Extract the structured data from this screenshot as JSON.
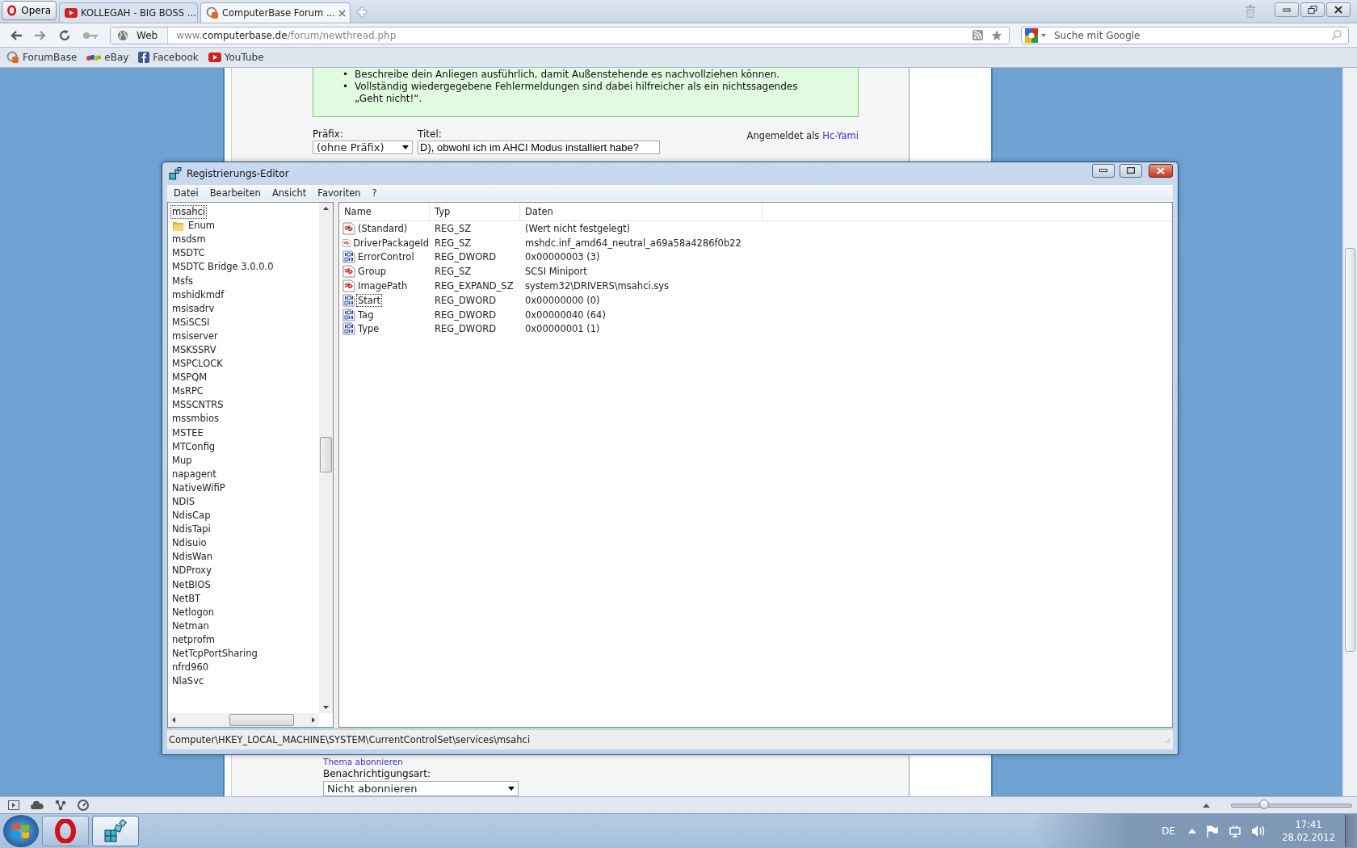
{
  "browser": {
    "menu_button": "Opera",
    "tabs": [
      {
        "title": "KOLLEGAH - BIG BOSS ...",
        "kind": "video",
        "selected": false
      },
      {
        "title": "ComputerBase Forum ...",
        "kind": "forum",
        "selected": true
      }
    ],
    "scope": "Web",
    "url": "www.**computerbase.de**/forum/newthread.php",
    "search_placeholder": "Suche mit Google",
    "bookmarks": [
      {
        "label": "ForumBase",
        "kind": "forum"
      },
      {
        "label": "eBay",
        "kind": "shop"
      },
      {
        "label": "Facebook",
        "kind": "social"
      },
      {
        "label": "YouTube",
        "kind": "video"
      }
    ],
    "zoom_slider": {
      "level": 0.27
    }
  },
  "page": {
    "hints": [
      {
        "marker": "•",
        "text": "Beschreibe dein Anliegen ausführlich, damit Außenstehende es nachvollziehen können."
      },
      {
        "marker": "•",
        "text": "Vollständig wiedergegebene Fehlermeldungen sind dabei hilfreicher als ein nichtssagendes „Geht nicht!“."
      }
    ],
    "prefix_label": "Präfix:",
    "prefix_value": "(ohne Präfix)",
    "title_label": "Titel:",
    "title_value": "D), obwohl ich im AHCI Modus installiert habe?",
    "logged_in_text": "Angemeldet als",
    "user_link": "Hc-Yami",
    "subscribe_link": "Thema abonnieren",
    "notification_label": "Benachrichtigungsart:",
    "notification_value": "Nicht abonnieren"
  },
  "regedit": {
    "title": "Registrierungs-Editor",
    "menu": [
      "Datei",
      "Bearbeiten",
      "Ansicht",
      "Favoriten",
      "?"
    ],
    "tree": [
      {
        "label": "msahci",
        "selected": true,
        "children": [
          {
            "label": "Enum",
            "selected": false
          }
        ]
      },
      {
        "label": "msdsm",
        "selected": false
      },
      {
        "label": "MSDTC",
        "selected": false
      },
      {
        "label": "MSDTC Bridge 3.0.0.0",
        "selected": false
      },
      {
        "label": "Msfs",
        "selected": false
      },
      {
        "label": "mshidkmdf",
        "selected": false
      },
      {
        "label": "msisadrv",
        "selected": false
      },
      {
        "label": "MSiSCSI",
        "selected": false
      },
      {
        "label": "msiserver",
        "selected": false
      },
      {
        "label": "MSKSSRV",
        "selected": false
      },
      {
        "label": "MSPCLOCK",
        "selected": false
      },
      {
        "label": "MSPQM",
        "selected": false
      },
      {
        "label": "MsRPC",
        "selected": false
      },
      {
        "label": "MSSCNTRS",
        "selected": false
      },
      {
        "label": "mssmbios",
        "selected": false
      },
      {
        "label": "MSTEE",
        "selected": false
      },
      {
        "label": "MTConfig",
        "selected": false
      },
      {
        "label": "Mup",
        "selected": false
      },
      {
        "label": "napagent",
        "selected": false
      },
      {
        "label": "NativeWifiP",
        "selected": false
      },
      {
        "label": "NDIS",
        "selected": false
      },
      {
        "label": "NdisCap",
        "selected": false
      },
      {
        "label": "NdisTapi",
        "selected": false
      },
      {
        "label": "Ndisuio",
        "selected": false
      },
      {
        "label": "NdisWan",
        "selected": false
      },
      {
        "label": "NDProxy",
        "selected": false
      },
      {
        "label": "NetBIOS",
        "selected": false
      },
      {
        "label": "NetBT",
        "selected": false
      },
      {
        "label": "Netlogon",
        "selected": false
      },
      {
        "label": "Netman",
        "selected": false
      },
      {
        "label": "netprofm",
        "selected": false
      },
      {
        "label": "NetTcpPortSharing",
        "selected": false
      },
      {
        "label": "nfrd960",
        "selected": false
      },
      {
        "label": "NlaSvc",
        "selected": false
      }
    ],
    "columns": [
      "Name",
      "Typ",
      "Daten"
    ],
    "values": [
      {
        "name": "(Standard)",
        "type": "REG_SZ",
        "data": "(Wert nicht festgelegt)",
        "kind": "string",
        "selected": false
      },
      {
        "name": "DriverPackageId",
        "type": "REG_SZ",
        "data": "mshdc.inf_amd64_neutral_a69a58a4286f0b22",
        "kind": "string",
        "selected": false
      },
      {
        "name": "ErrorControl",
        "type": "REG_DWORD",
        "data": "0x00000003 (3)",
        "kind": "binary",
        "selected": false
      },
      {
        "name": "Group",
        "type": "REG_SZ",
        "data": "SCSI Miniport",
        "kind": "string",
        "selected": false
      },
      {
        "name": "ImagePath",
        "type": "REG_EXPAND_SZ",
        "data": "system32\\DRIVERS\\msahci.sys",
        "kind": "string",
        "selected": false
      },
      {
        "name": "Start",
        "type": "REG_DWORD",
        "data": "0x00000000 (0)",
        "kind": "binary",
        "selected": true
      },
      {
        "name": "Tag",
        "type": "REG_DWORD",
        "data": "0x00000040 (64)",
        "kind": "binary",
        "selected": false
      },
      {
        "name": "Type",
        "type": "REG_DWORD",
        "data": "0x00000001 (1)",
        "kind": "binary",
        "selected": false
      }
    ],
    "status_path": "Computer\\HKEY_LOCAL_MACHINE\\SYSTEM\\CurrentControlSet\\services\\msahci"
  },
  "taskbar": {
    "apps": [
      {
        "kind": "browser",
        "selected": false
      },
      {
        "kind": "registry",
        "selected": true
      }
    ],
    "language": "DE",
    "time": "17:41",
    "date": "28.02.2012"
  }
}
